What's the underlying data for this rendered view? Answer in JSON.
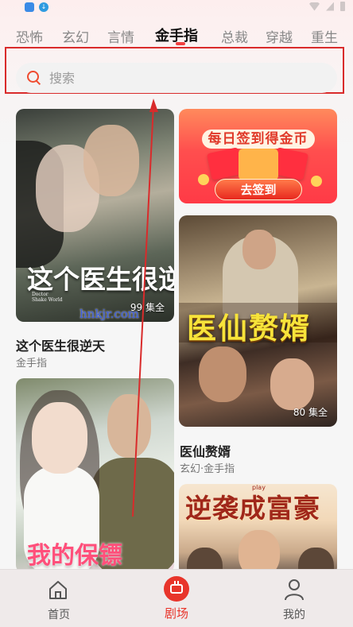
{
  "tabs": [
    {
      "label": "恐怖"
    },
    {
      "label": "玄幻"
    },
    {
      "label": "言情"
    },
    {
      "label": "金手指"
    },
    {
      "label": "总裁"
    },
    {
      "label": "穿越"
    },
    {
      "label": "重生"
    }
  ],
  "active_tab": "金手指",
  "search": {
    "placeholder": "搜索"
  },
  "cards": [
    {
      "poster_title": "这个医生很逆天",
      "poster_subtitle": "Doctor Shake World",
      "episodes": "99 集全",
      "name": "这个医生很逆天",
      "tags": "金手指"
    },
    {
      "poster_title": "我的保镖",
      "name": "",
      "tags": ""
    },
    {
      "poster_title": "医仙赘婿",
      "episodes": "80 集全",
      "name": "医仙赘婿",
      "tags": "玄幻·金手指"
    },
    {
      "poster_title": "逆袭成富豪",
      "poster_tag": "play"
    }
  ],
  "banner": {
    "title": "每日签到得金币",
    "button": "去签到"
  },
  "watermark": "hnkjr.com",
  "bottom_nav": [
    {
      "label": "首页",
      "icon": "home-icon"
    },
    {
      "label": "剧场",
      "icon": "theater-icon"
    },
    {
      "label": "我的",
      "icon": "profile-icon"
    }
  ],
  "colors": {
    "accent": "#e8352b",
    "highlight_outline": "#d92b2b"
  }
}
